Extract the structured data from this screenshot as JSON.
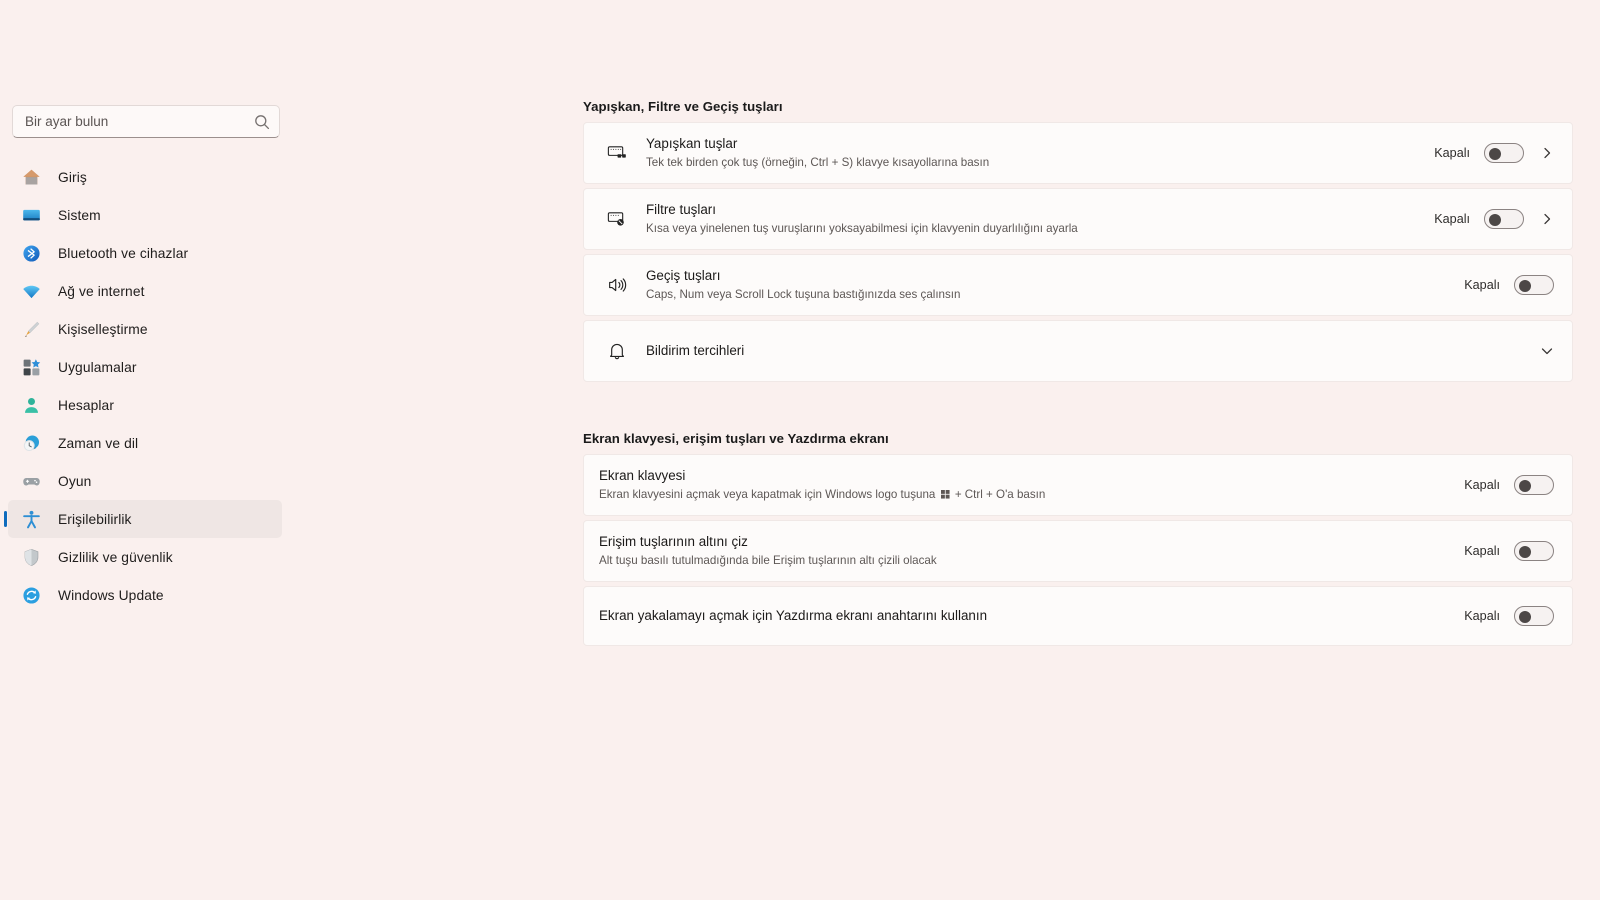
{
  "search": {
    "placeholder": "Bir ayar bulun",
    "value": "",
    "icon": "search-icon"
  },
  "sidebar": {
    "items": [
      {
        "label": "Giriş",
        "icon": "home-icon",
        "selected": false
      },
      {
        "label": "Sistem",
        "icon": "monitor-icon",
        "selected": false
      },
      {
        "label": "Bluetooth ve cihazlar",
        "icon": "bluetooth-icon",
        "selected": false
      },
      {
        "label": "Ağ ve internet",
        "icon": "wifi-icon",
        "selected": false
      },
      {
        "label": "Kişiselleştirme",
        "icon": "paintbrush-icon",
        "selected": false
      },
      {
        "label": "Uygulamalar",
        "icon": "apps-icon",
        "selected": false
      },
      {
        "label": "Hesaplar",
        "icon": "person-icon",
        "selected": false
      },
      {
        "label": "Zaman ve dil",
        "icon": "clock-globe-icon",
        "selected": false
      },
      {
        "label": "Oyun",
        "icon": "gamepad-icon",
        "selected": false
      },
      {
        "label": "Erişilebilirlik",
        "icon": "accessibility-icon",
        "selected": true
      },
      {
        "label": "Gizlilik ve güvenlik",
        "icon": "shield-icon",
        "selected": false
      },
      {
        "label": "Windows Update",
        "icon": "update-icon",
        "selected": false
      }
    ]
  },
  "main": {
    "sections": [
      {
        "title": "Yapışkan, Filtre ve Geçiş tuşları",
        "cards": [
          {
            "icon": "sticky-keys-icon",
            "title": "Yapışkan tuşlar",
            "desc": "Tek tek birden çok tuş (örneğin, Ctrl + S) klavye kısayollarına basın",
            "state": "Kapalı",
            "toggle": "off",
            "chevron": "chevron-right"
          },
          {
            "icon": "filter-keys-icon",
            "title": "Filtre tuşları",
            "desc": "Kısa veya yinelenen tuş vuruşlarını yoksayabilmesi için klavyenin duyarlılığını ayarla",
            "state": "Kapalı",
            "toggle": "off",
            "chevron": "chevron-right"
          },
          {
            "icon": "speaker-icon",
            "title": "Geçiş tuşları",
            "desc": "Caps, Num veya Scroll Lock tuşuna bastığınızda ses çalınsın",
            "state": "Kapalı",
            "toggle": "off",
            "chevron": ""
          },
          {
            "icon": "bell-icon",
            "title": "Bildirim tercihleri",
            "desc": "",
            "state": "",
            "toggle": "",
            "chevron": "chevron-down"
          }
        ]
      },
      {
        "title": "Ekran klavyesi, erişim tuşları ve Yazdırma ekranı",
        "cards": [
          {
            "icon": "",
            "title": "Ekran klavyesi",
            "desc_before": "Ekran klavyesini açmak veya kapatmak için Windows logo tuşuna ",
            "desc_after": " + Ctrl + O'a basın",
            "desc": "Ekran klavyesini açmak veya kapatmak için Windows logo tuşuna ⊞ + Ctrl + O'a basın",
            "state": "Kapalı",
            "toggle": "off",
            "chevron": ""
          },
          {
            "icon": "",
            "title": "Erişim tuşlarının altını çiz",
            "desc": "Alt tuşu basılı tutulmadığında bile Erişim tuşlarının altı çizili olacak",
            "state": "Kapalı",
            "toggle": "off",
            "chevron": ""
          },
          {
            "icon": "",
            "title": "Ekran yakalamayı açmak için Yazdırma ekranı anahtarını kullanın",
            "desc": "",
            "state": "Kapalı",
            "toggle": "off",
            "chevron": ""
          }
        ]
      }
    ]
  },
  "colors": {
    "page_background": "#faf0ee",
    "card_background": "#fdfbfa",
    "accent": "#0f6cbd",
    "selected_nav_background": "#efe6e4"
  }
}
